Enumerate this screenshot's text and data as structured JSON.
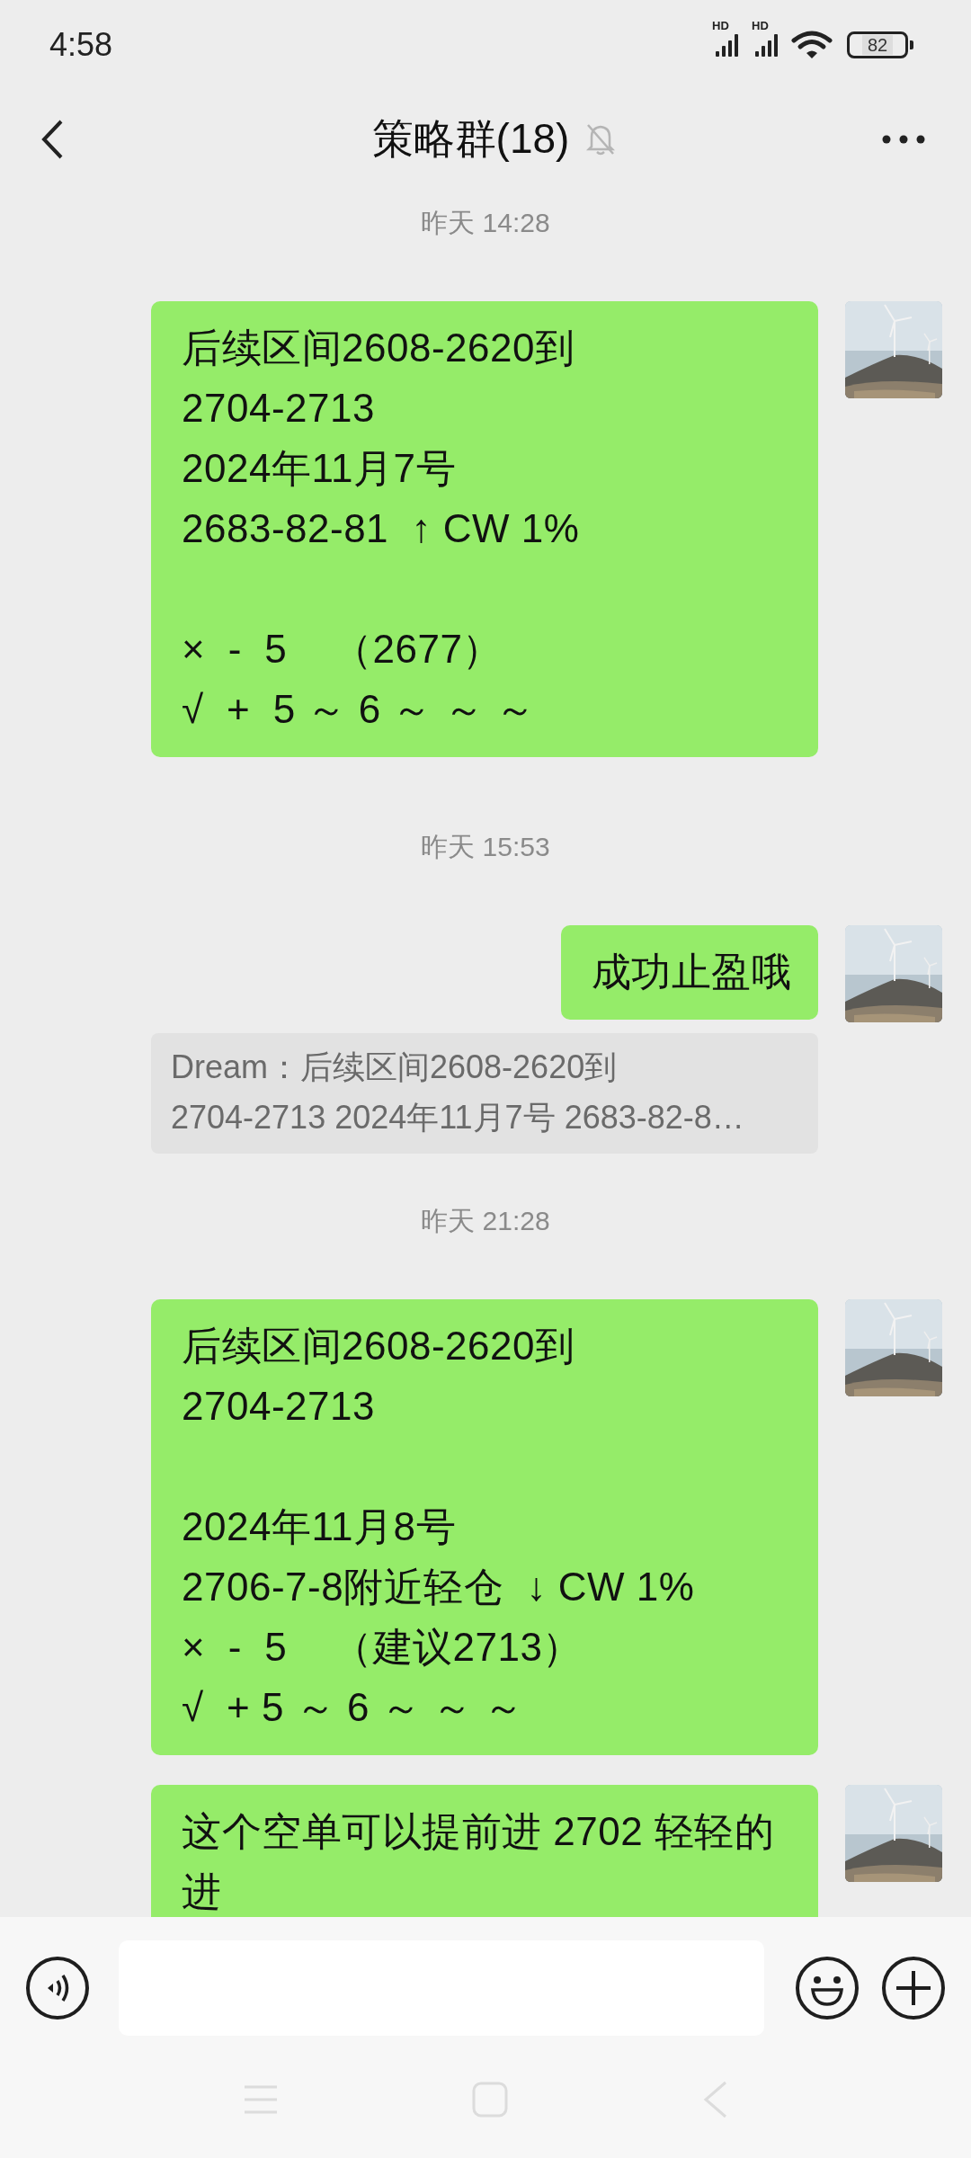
{
  "status_bar": {
    "time": "4:58",
    "signals": [
      {
        "label": "HD"
      },
      {
        "label": "HD"
      }
    ],
    "battery": "82"
  },
  "header": {
    "title": "策略群(18)",
    "muted": true
  },
  "messages": [
    {
      "kind": "time",
      "text": "昨天 14:28"
    },
    {
      "kind": "text",
      "text": "后续区间2608-2620到\n2704-2713\n2024年11月7号\n2683-82-81  ↑ CW 1%\n\n×  -  5    （2677）\n√  +  5 ～ 6 ～ ～ ～"
    },
    {
      "kind": "time",
      "text": "昨天 15:53"
    },
    {
      "kind": "text",
      "text": "成功止盈哦"
    },
    {
      "kind": "quote",
      "text": "Dream：后续区间2608-2620到\n2704-2713 2024年11月7号 2683-82-8…"
    },
    {
      "kind": "time",
      "text": "昨天 21:28"
    },
    {
      "kind": "text",
      "text": "后续区间2608-2620到\n2704-2713\n\n2024年11月8号\n2706-7-8附近轻仓  ↓ CW 1%\n×  -  5    （建议2713）\n√  + 5 ～ 6 ～ ～ ～"
    },
    {
      "kind": "text",
      "text": "这个空单可以提前进 2702 轻轻的进"
    }
  ]
}
